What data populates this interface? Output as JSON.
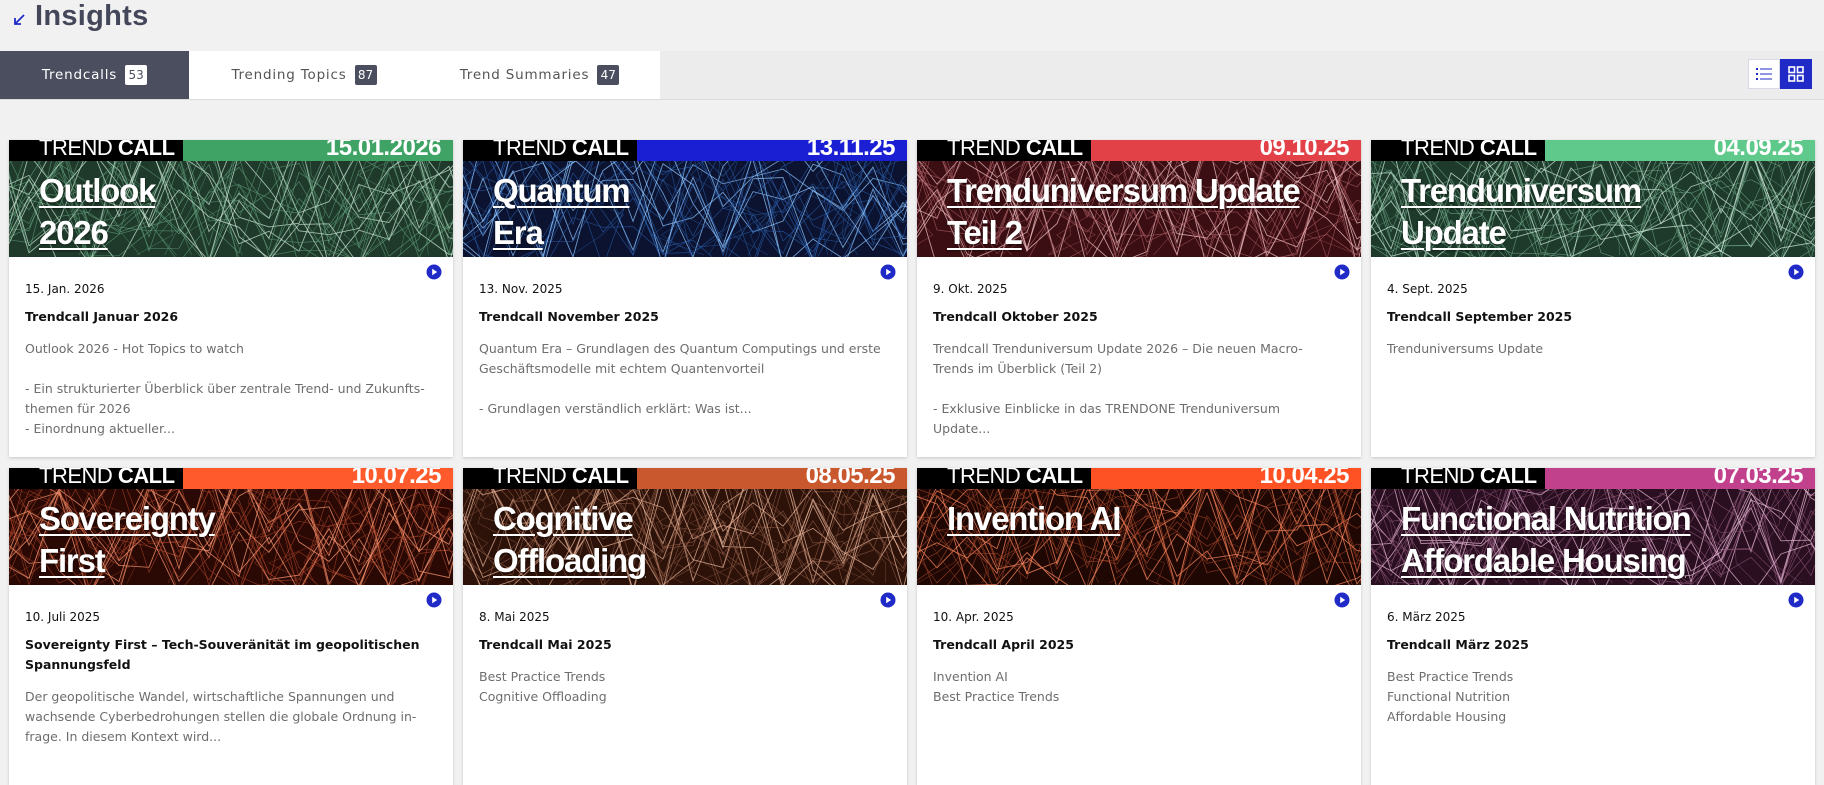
{
  "header": {
    "title": "Insights",
    "icon": "arrow-down-left-icon"
  },
  "tabs": [
    {
      "label": "Trendcalls",
      "count": "53",
      "active": true
    },
    {
      "label": "Trending Topics",
      "count": "87",
      "active": false
    },
    {
      "label": "Trend Summaries",
      "count": "47",
      "active": false
    }
  ],
  "view_toggle": {
    "list": "list-view-icon",
    "grid": "grid-view-icon",
    "active": "grid"
  },
  "colors": {
    "accent": "#1f2ac7",
    "tab_active": "#4b4e5e"
  },
  "cards": [
    {
      "banner_word1": "TREND ",
      "banner_word2": "CALL",
      "banner_date": "15.01.2026",
      "banner_color": "#3fa366",
      "theme": [
        "#1f3a2a",
        "#5f9a78",
        "#c9e6d4"
      ],
      "image_title": [
        "Outlook",
        "2026"
      ],
      "date": "15. Jan. 2026",
      "title": "Trendcall Januar 2026",
      "description": "Outlook 2026 - Hot Topics to watch\n\n- Ein strukturierter Überblick über zentrale Trend- und Zukunfts-\nthemen für 2026\n- Einordnung aktueller..."
    },
    {
      "banner_word1": "TREND ",
      "banner_word2": "CALL",
      "banner_date": "13.11.25",
      "banner_color": "#1a1fd4",
      "theme": [
        "#0b1330",
        "#2b5ba5",
        "#8ec6ff"
      ],
      "image_title": [
        "Quantum",
        "Era"
      ],
      "date": "13. Nov. 2025",
      "title": "Trendcall November 2025",
      "description": "Quantum Era – Grundlagen des Quantum Computings und erste\nGeschäftsmodelle mit echtem Quantenvorteil\n\n- Grundlagen verständlich erklärt: Was ist..."
    },
    {
      "banner_word1": "TREND ",
      "banner_word2": "CALL",
      "banner_date": "09.10.25",
      "banner_color": "#e24148",
      "theme": [
        "#3a0e12",
        "#a85c63",
        "#f2c2c6"
      ],
      "image_title": [
        "Trenduniversum Update",
        "Teil 2"
      ],
      "date": "9. Okt. 2025",
      "title": "Trendcall Oktober 2025",
      "description": "Trendcall Trenduniversum Update 2026 – Die neuen Macro-\nTrends im Überblick (Teil 2)\n\n- Exklusive Einblicke in das TRENDONE Trenduniversum\nUpdate..."
    },
    {
      "banner_word1": "TREND ",
      "banner_word2": "CALL",
      "banner_date": "04.09.25",
      "banner_color": "#5fc98b",
      "theme": [
        "#1d3a2b",
        "#6fa486",
        "#d2ecdd"
      ],
      "image_title": [
        "Trenduniversum",
        "Update"
      ],
      "date": "4. Sept. 2025",
      "title": "Trendcall September 2025",
      "description": "Trenduniversums Update"
    },
    {
      "banner_word1": "TREND ",
      "banner_word2": "CALL",
      "banner_date": "10.07.25",
      "banner_color": "#ff5a2c",
      "theme": [
        "#2a0904",
        "#a64128",
        "#ff9b76"
      ],
      "image_title": [
        "Sovereignty",
        "First"
      ],
      "date": "10. Juli 2025",
      "title": "Sovereignty First – Tech-Souveränität im geopolitischen\nSpannungsfeld",
      "description": "Der geopolitische Wandel, wirtschaftliche Spannungen und\nwachsende Cyberbedrohungen stellen die globale Ordnung in-\nfrage. In diesem Kontext wird..."
    },
    {
      "banner_word1": "TREND ",
      "banner_word2": "CALL",
      "banner_date": "08.05.25",
      "banner_color": "#c9582f",
      "theme": [
        "#2c1209",
        "#8d5a44",
        "#e8b49a"
      ],
      "image_title": [
        "Cognitive",
        "Offloading"
      ],
      "date": "8. Mai 2025",
      "title": "Trendcall Mai 2025",
      "description": "Best Practice Trends\nCognitive Offloading"
    },
    {
      "banner_word1": "TREND ",
      "banner_word2": "CALL",
      "banner_date": "10.04.25",
      "banner_color": "#ff5224",
      "theme": [
        "#1f0703",
        "#a2452a",
        "#ff8a60"
      ],
      "image_title": [
        "Invention AI"
      ],
      "date": "10. Apr. 2025",
      "title": "Trendcall April 2025",
      "description": "Invention AI\nBest Practice Trends"
    },
    {
      "banner_word1": "TREND ",
      "banner_word2": "CALL",
      "banner_date": "07.03.25",
      "banner_color": "#c1418c",
      "theme": [
        "#2a0f20",
        "#8b5578",
        "#e7b9d6"
      ],
      "image_title": [
        "Functional Nutrition",
        "Affordable Housing"
      ],
      "date": "6. März 2025",
      "title": "Trendcall März 2025",
      "description": "Best Practice Trends\nFunctional Nutrition\nAffordable Housing"
    }
  ]
}
